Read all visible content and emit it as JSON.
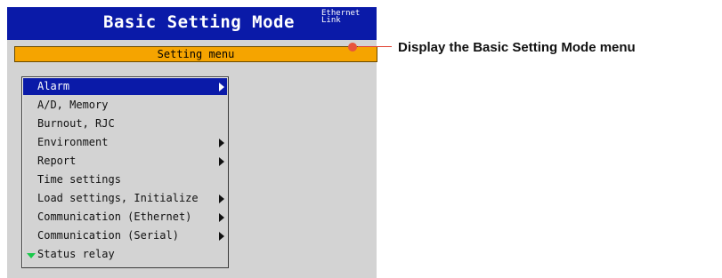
{
  "title_bar": {
    "title": "Basic Setting Mode",
    "network_status": "Ethernet\nLink"
  },
  "setting_menu_bar": {
    "label": "Setting menu"
  },
  "callout": {
    "text": "Display the Basic Setting Mode menu"
  },
  "menu": {
    "items": [
      {
        "label": "Alarm",
        "has_submenu": true,
        "selected": true
      },
      {
        "label": "A/D, Memory",
        "has_submenu": false,
        "selected": false
      },
      {
        "label": "Burnout, RJC",
        "has_submenu": false,
        "selected": false
      },
      {
        "label": "Environment",
        "has_submenu": true,
        "selected": false
      },
      {
        "label": "Report",
        "has_submenu": true,
        "selected": false
      },
      {
        "label": "Time settings",
        "has_submenu": false,
        "selected": false
      },
      {
        "label": "Load settings, Initialize",
        "has_submenu": true,
        "selected": false
      },
      {
        "label": "Communication (Ethernet)",
        "has_submenu": true,
        "selected": false
      },
      {
        "label": "Communication (Serial)",
        "has_submenu": true,
        "selected": false
      },
      {
        "label": "Status relay",
        "has_submenu": false,
        "selected": false,
        "scroll_indicator": true
      }
    ]
  },
  "colors": {
    "title_bar": "#0a1aa8",
    "setting_bar": "#f5a400",
    "selection": "#0a1aa8",
    "panel": "#d3d3d3",
    "callout_marker": "#e8543c",
    "scroll_arrow": "#19c94a"
  },
  "icons": {
    "submenu": "chevron-right-icon",
    "scroll": "scroll-down-icon"
  }
}
